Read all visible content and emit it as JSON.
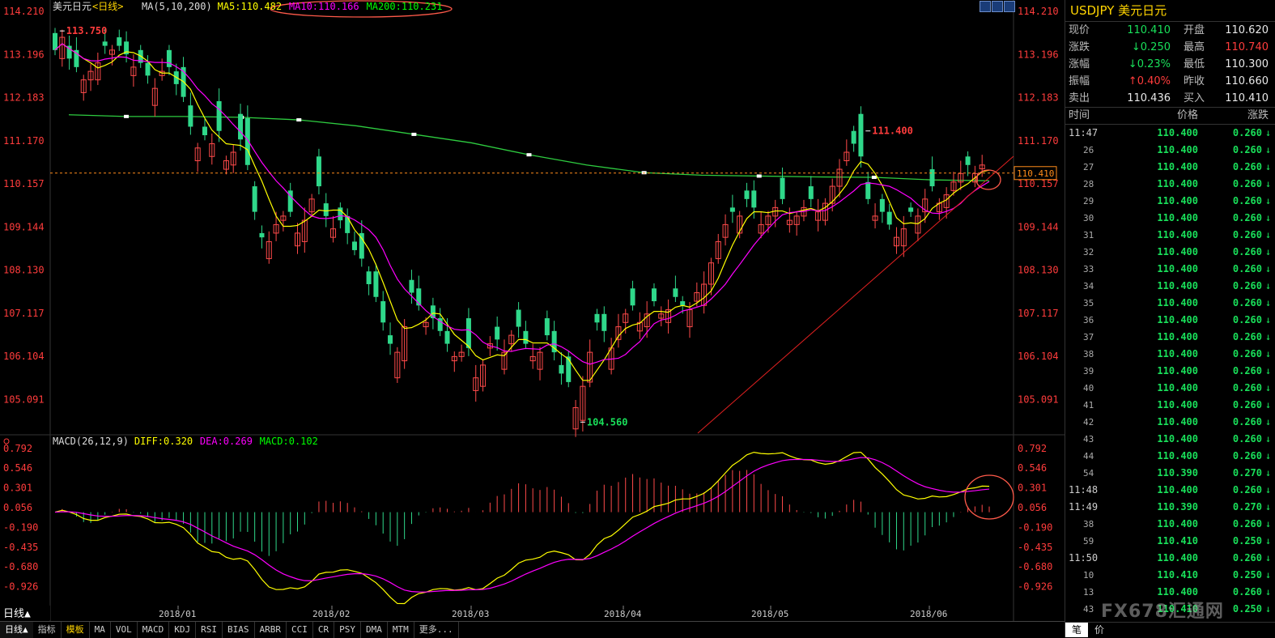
{
  "chart_data": [
    {
      "type": "candlestick",
      "title": "美元日元",
      "period": "日线",
      "indicator_label": "MA(5,10,200)",
      "legend": [
        {
          "name": "MA5",
          "value": "110.482",
          "color": "#ffff00"
        },
        {
          "name": "MA10",
          "value": "110.166",
          "color": "#ff00ff"
        },
        {
          "name": "MA200",
          "value": "110.231",
          "color": "#00ff00"
        }
      ],
      "y_ticks": [
        "114.210",
        "113.196",
        "112.183",
        "111.170",
        "110.157",
        "109.144",
        "108.130",
        "107.117",
        "106.104",
        "105.091"
      ],
      "ylim": [
        104.3,
        114.21
      ],
      "x_ticks": [
        "2018/01",
        "2018/02",
        "2018/03",
        "2018/04",
        "2018/05",
        "2018/06"
      ],
      "current_price": "110.410",
      "annotations": [
        {
          "text": "113.750",
          "value": 113.75
        },
        {
          "text": "111.400",
          "value": 111.4
        },
        {
          "text": "104.560",
          "value": 104.56
        }
      ],
      "ma200_values": [
        111.78,
        111.74,
        111.74,
        111.72,
        111.66,
        111.52,
        111.32,
        111.12,
        110.84,
        110.6,
        110.42,
        110.36,
        110.34,
        110.32,
        110.31,
        110.25,
        110.23
      ],
      "closes": [
        113.3,
        113.6,
        113.1,
        112.9,
        112.6,
        112.8,
        113.0,
        113.4,
        113.3,
        113.4,
        113.2,
        112.9,
        113.0,
        112.7,
        112.4,
        112.8,
        112.9,
        112.5,
        112.2,
        111.5,
        111.0,
        111.3,
        111.1,
        111.4,
        110.7,
        110.9,
        111.2,
        110.6,
        109.5,
        108.9,
        108.8,
        109.2,
        109.4,
        109.5,
        109.0,
        109.3,
        109.8,
        110.1,
        109.4,
        109.1,
        109.3,
        109.0,
        108.6,
        108.4,
        107.8,
        107.5,
        106.9,
        106.4,
        106.2,
        106.8,
        107.6,
        107.3,
        106.9,
        107.0,
        106.7,
        106.4,
        106.1,
        106.2,
        106.3,
        105.6,
        105.9,
        106.4,
        106.5,
        106.2,
        106.6,
        106.8,
        106.4,
        106.1,
        106.2,
        106.6,
        106.2,
        105.7,
        105.5,
        104.9,
        105.4,
        106.2,
        106.9,
        106.7,
        106.3,
        106.8,
        107.1,
        107.3,
        106.9,
        107.1,
        107.4,
        107.1,
        107.2,
        107.5,
        107.3,
        107.2,
        107.6,
        107.8,
        108.3,
        108.8,
        109.2,
        109.5,
        109.4,
        109.8,
        109.6,
        109.2,
        109.4,
        109.6,
        109.8,
        109.3,
        109.4,
        109.6,
        109.8,
        109.5,
        109.7,
        110.1,
        110.5,
        110.9,
        111.1,
        110.8,
        109.8,
        109.4,
        109.5,
        109.2,
        108.9,
        109.1,
        109.5,
        109.4,
        109.8,
        110.1,
        109.7,
        109.9,
        110.2,
        110.4,
        110.6,
        110.4,
        110.6,
        110.41
      ],
      "opens_delta": [
        0.4,
        -0.5,
        0.3,
        0.4,
        -0.3,
        -0.2,
        -0.4,
        0.1,
        -0.1,
        0.2,
        0.3,
        -0.2,
        0.3,
        0.3,
        -0.4,
        -0.1,
        0.4,
        0.3,
        0.7,
        0.5,
        -0.3,
        0.2,
        -0.3,
        0.7,
        -0.2,
        -0.3,
        0.6,
        1.1,
        0.6,
        0.1,
        -0.4,
        -0.2,
        -0.1,
        0.5,
        -0.3,
        -0.5,
        -0.3,
        0.7,
        0.3,
        -0.2,
        0.3,
        0.4,
        0.2,
        0.6,
        0.3,
        0.6,
        0.5,
        0.2,
        -0.6,
        -0.8,
        0.3,
        0.4,
        -0.1,
        0.3,
        0.3,
        0.3,
        -0.1,
        -0.1,
        0.7,
        -0.3,
        -0.5,
        -0.1,
        0.3,
        -0.4,
        -0.2,
        0.4,
        0.3,
        -0.1,
        -0.4,
        0.4,
        0.5,
        0.2,
        0.6,
        -0.5,
        -0.8,
        -0.7,
        0.2,
        0.4,
        -0.5,
        -0.3,
        -0.2,
        0.4,
        -0.2,
        -0.3,
        0.3,
        -0.1,
        -0.3,
        0.2,
        0.1,
        -0.4,
        -0.2,
        -0.5,
        -0.5,
        -0.4,
        -0.3,
        0.1,
        -0.4,
        0.2,
        0.4,
        -0.2,
        -0.2,
        -0.2,
        0.5,
        -0.1,
        -0.2,
        -0.2,
        0.3,
        -0.2,
        -0.4,
        -0.4,
        -0.4,
        -0.2,
        0.3,
        1.0,
        0.4,
        -0.1,
        0.3,
        0.3,
        -0.2,
        -0.4,
        0.1,
        -0.4,
        -0.3,
        0.4,
        -0.2,
        -0.3,
        -0.2,
        -0.2,
        0.2,
        -0.2,
        -0.09
      ]
    },
    {
      "type": "macd",
      "indicator_label": "MACD(26,12,9)",
      "legend": [
        {
          "name": "DIFF",
          "value": "0.320",
          "color": "#ffff00"
        },
        {
          "name": "DEA",
          "value": "0.269",
          "color": "#ff00ff"
        },
        {
          "name": "MACD",
          "value": "0.102",
          "color": "#00ff00"
        }
      ],
      "y_ticks": [
        "0.792",
        "0.546",
        "0.301",
        "0.056",
        "-0.190",
        "-0.435",
        "-0.680",
        "-0.926"
      ],
      "ylim": [
        -1.1,
        0.85
      ]
    }
  ],
  "toolbar_tabs": [
    "指标",
    "模板",
    "MA",
    "VOL",
    "MACD",
    "KDJ",
    "RSI",
    "BIAS",
    "ARBR",
    "CCI",
    "CR",
    "PSY",
    "DMA",
    "MTM",
    "更多..."
  ],
  "period_button": "日线▲",
  "quote": {
    "symbol": "USDJPY 美元日元",
    "rows": [
      {
        "l1": "现价",
        "v1": "110.410",
        "c1": "green",
        "l2": "开盘",
        "v2": "110.620",
        "c2": "white"
      },
      {
        "l1": "涨跌",
        "v1": "↓0.250",
        "c1": "green",
        "l2": "最高",
        "v2": "110.740",
        "c2": "red"
      },
      {
        "l1": "涨幅",
        "v1": "↓0.23%",
        "c1": "green",
        "l2": "最低",
        "v2": "110.300",
        "c2": "white"
      },
      {
        "l1": "振幅",
        "v1": "↑0.40%",
        "c1": "red",
        "l2": "昨收",
        "v2": "110.660",
        "c2": "white"
      },
      {
        "l1": "卖出",
        "v1": "110.436",
        "c1": "white",
        "l2": "买入",
        "v2": "110.410",
        "c2": "white"
      }
    ],
    "headers": [
      "时间",
      "价格",
      "涨跌"
    ],
    "ticks": [
      {
        "t": "11:47",
        "p": "110.400",
        "c": "0.260",
        "minor": false
      },
      {
        "t": "26",
        "p": "110.400",
        "c": "0.260",
        "minor": true
      },
      {
        "t": "27",
        "p": "110.400",
        "c": "0.260",
        "minor": true
      },
      {
        "t": "28",
        "p": "110.400",
        "c": "0.260",
        "minor": true
      },
      {
        "t": "29",
        "p": "110.400",
        "c": "0.260",
        "minor": true
      },
      {
        "t": "30",
        "p": "110.400",
        "c": "0.260",
        "minor": true
      },
      {
        "t": "31",
        "p": "110.400",
        "c": "0.260",
        "minor": true
      },
      {
        "t": "32",
        "p": "110.400",
        "c": "0.260",
        "minor": true
      },
      {
        "t": "33",
        "p": "110.400",
        "c": "0.260",
        "minor": true
      },
      {
        "t": "34",
        "p": "110.400",
        "c": "0.260",
        "minor": true
      },
      {
        "t": "35",
        "p": "110.400",
        "c": "0.260",
        "minor": true
      },
      {
        "t": "36",
        "p": "110.400",
        "c": "0.260",
        "minor": true
      },
      {
        "t": "37",
        "p": "110.400",
        "c": "0.260",
        "minor": true
      },
      {
        "t": "38",
        "p": "110.400",
        "c": "0.260",
        "minor": true
      },
      {
        "t": "39",
        "p": "110.400",
        "c": "0.260",
        "minor": true
      },
      {
        "t": "40",
        "p": "110.400",
        "c": "0.260",
        "minor": true
      },
      {
        "t": "41",
        "p": "110.400",
        "c": "0.260",
        "minor": true
      },
      {
        "t": "42",
        "p": "110.400",
        "c": "0.260",
        "minor": true
      },
      {
        "t": "43",
        "p": "110.400",
        "c": "0.260",
        "minor": true
      },
      {
        "t": "44",
        "p": "110.400",
        "c": "0.260",
        "minor": true
      },
      {
        "t": "54",
        "p": "110.390",
        "c": "0.270",
        "minor": true
      },
      {
        "t": "11:48",
        "p": "110.400",
        "c": "0.260",
        "minor": false
      },
      {
        "t": "11:49",
        "p": "110.390",
        "c": "0.270",
        "minor": false
      },
      {
        "t": "38",
        "p": "110.400",
        "c": "0.260",
        "minor": true
      },
      {
        "t": "59",
        "p": "110.410",
        "c": "0.250",
        "minor": true
      },
      {
        "t": "11:50",
        "p": "110.400",
        "c": "0.260",
        "minor": false
      },
      {
        "t": "10",
        "p": "110.410",
        "c": "0.250",
        "minor": true
      },
      {
        "t": "13",
        "p": "110.400",
        "c": "0.260",
        "minor": true
      },
      {
        "t": "43",
        "p": "110.410",
        "c": "0.250",
        "minor": true
      }
    ],
    "footer": [
      "笔",
      "价"
    ]
  },
  "watermark": "FX678汇通网"
}
